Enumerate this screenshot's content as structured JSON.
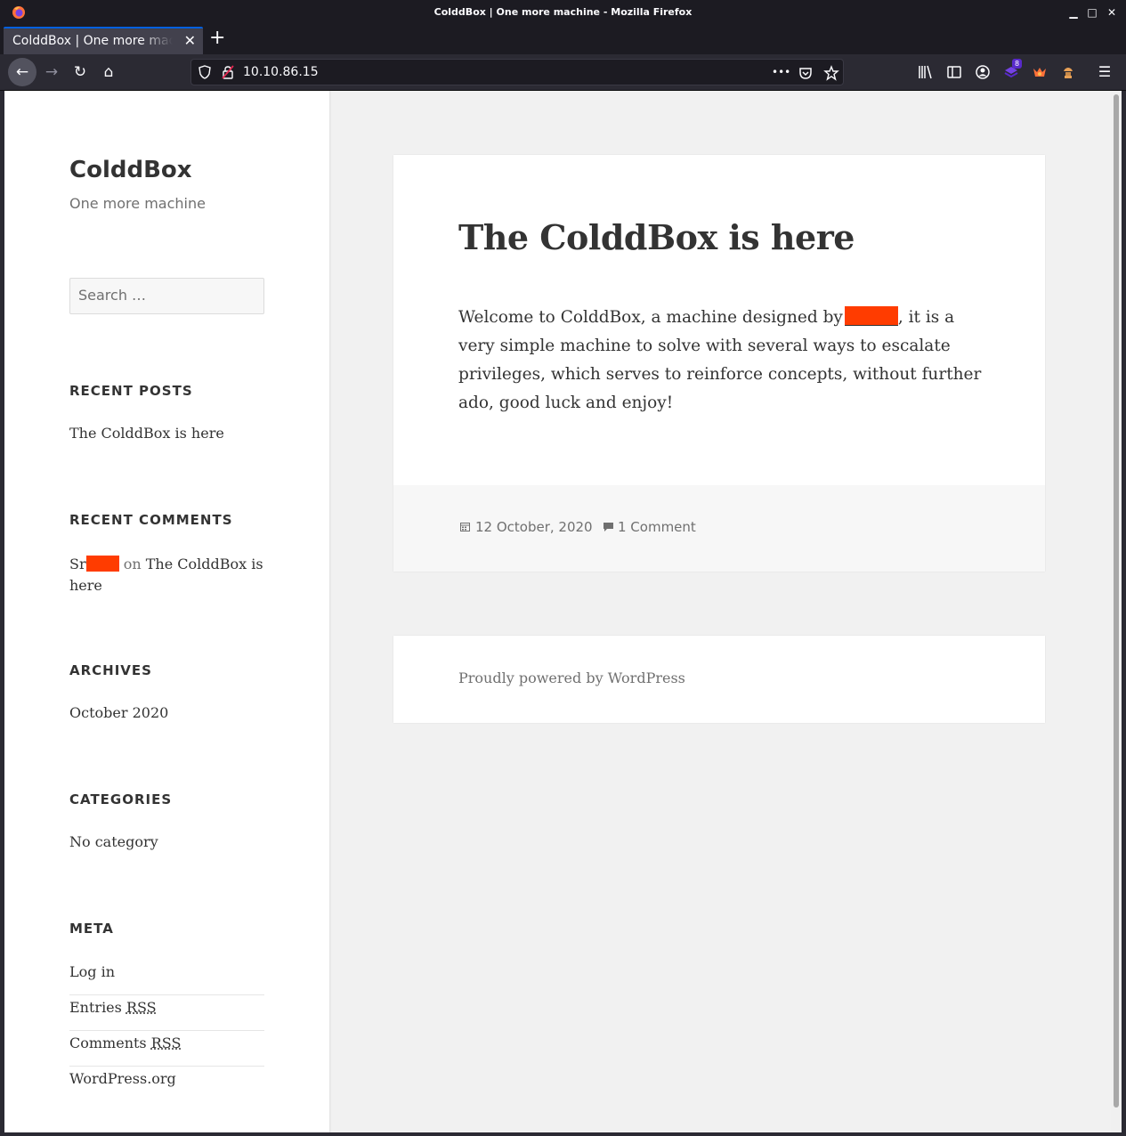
{
  "window": {
    "title": "ColddBox | One more machine - Mozilla Firefox",
    "minimize": "▁",
    "maximize": "□",
    "close": "✕"
  },
  "tabs": [
    {
      "label": "ColddBox | One more machine",
      "close": "✕"
    }
  ],
  "newtab": "+",
  "nav": {
    "back": "←",
    "forward": "→",
    "reload": "↻",
    "home": "⌂",
    "url": "10.10.86.15",
    "more": "•••",
    "menu": "☰",
    "extension_badge": "8"
  },
  "sidebar": {
    "site_title": "ColddBox",
    "site_description": "One more machine",
    "search_placeholder": "Search …",
    "recent_posts": {
      "title": "RECENT POSTS",
      "items": [
        "The ColddBox is here"
      ]
    },
    "recent_comments": {
      "title": "RECENT COMMENTS",
      "author_prefix": "Sr",
      "on": "on",
      "post_line1": "The ColddBox is",
      "post_line2": "here"
    },
    "archives": {
      "title": "ARCHIVES",
      "items": [
        "October 2020"
      ]
    },
    "categories": {
      "title": "CATEGORIES",
      "items": [
        "No category"
      ]
    },
    "meta": {
      "title": "META",
      "items": [
        {
          "label": "Log in"
        },
        {
          "label": "Entries",
          "abbr": "RSS"
        },
        {
          "label": "Comments",
          "abbr": "RSS"
        },
        {
          "label": "WordPress.org"
        }
      ]
    }
  },
  "post": {
    "title": "The ColddBox is here",
    "body_before": "Welcome to ColddBox, a machine designed by",
    "body_after": ", it is a very simple machine to solve with several ways to escalate privileges, which serves to reinforce concepts, without further ado, good luck and enjoy!",
    "date": "12 October, 2020",
    "comments": "1 Comment"
  },
  "footer": {
    "powered": "Proudly powered by WordPress"
  },
  "colors": {
    "redaction": "#ff3c00",
    "accent_tab": "#0060df"
  }
}
